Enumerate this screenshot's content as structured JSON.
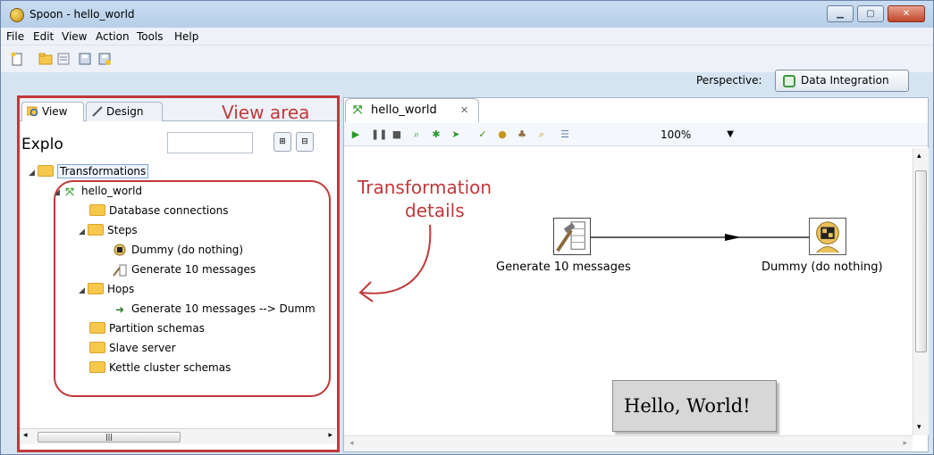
{
  "window": {
    "title": "Spoon - hello_world"
  },
  "menu": [
    "File",
    "Edit",
    "View",
    "Action",
    "Tools",
    "Help"
  ],
  "perspective": {
    "label": "Perspective:",
    "value": "Data Integration"
  },
  "left_panel": {
    "tabs": [
      "View",
      "Design"
    ],
    "annotation": "View area",
    "explorer_label": "Explo",
    "tree": [
      {
        "label": "Transformations"
      },
      {
        "label": "hello_world"
      },
      {
        "label": "Database connections"
      },
      {
        "label": "Steps"
      },
      {
        "label": "Dummy (do nothing)"
      },
      {
        "label": "Generate 10 messages"
      },
      {
        "label": "Hops"
      },
      {
        "label": "Generate 10 messages --> Dumm"
      },
      {
        "label": "Partition schemas"
      },
      {
        "label": "Slave server"
      },
      {
        "label": "Kettle cluster schemas"
      }
    ]
  },
  "editor": {
    "tab_label": "hello_world",
    "zoom": "100%",
    "annotation_line1": "Transformation",
    "annotation_line2": "details",
    "steps": {
      "generate": "Generate 10 messages",
      "dummy": "Dummy (do nothing)"
    },
    "note": "Hello, World!"
  },
  "colors": {
    "annotation": "#c0393b",
    "hop_arrow": "#000000"
  }
}
